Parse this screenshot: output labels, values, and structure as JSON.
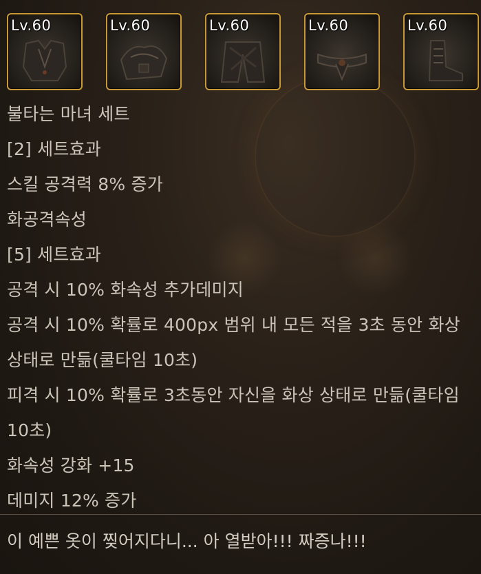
{
  "equipment": {
    "slots": [
      {
        "level": "Lv.60",
        "icon": "armor-top-icon"
      },
      {
        "level": "Lv.60",
        "icon": "armor-shoulder-icon"
      },
      {
        "level": "Lv.60",
        "icon": "armor-bottom-icon"
      },
      {
        "level": "Lv.60",
        "icon": "armor-belt-icon"
      },
      {
        "level": "Lv.60",
        "icon": "armor-shoes-icon"
      }
    ],
    "frame_color": "#c99a35"
  },
  "set_info": {
    "lines": [
      "불타는 마녀 세트",
      "[2] 세트효과",
      "스킬 공격력 8% 증가",
      "화공격속성",
      "[5] 세트효과",
      "공격 시 10% 화속성 추가데미지",
      "공격 시 10% 확률로 400px 범위 내 모든 적을 3초 동안 화상",
      "상태로 만듦(쿨타임 10초)",
      "피격 시 10% 확률로 3초동안 자신을 화상 상태로 만듦(쿨타임",
      "10초)",
      "화속성 강화 +15",
      "데미지 12% 증가"
    ]
  },
  "flavor_text": "이 예쁜 옷이 찢어지다니... 아 열받아!!! 짜증나!!!"
}
